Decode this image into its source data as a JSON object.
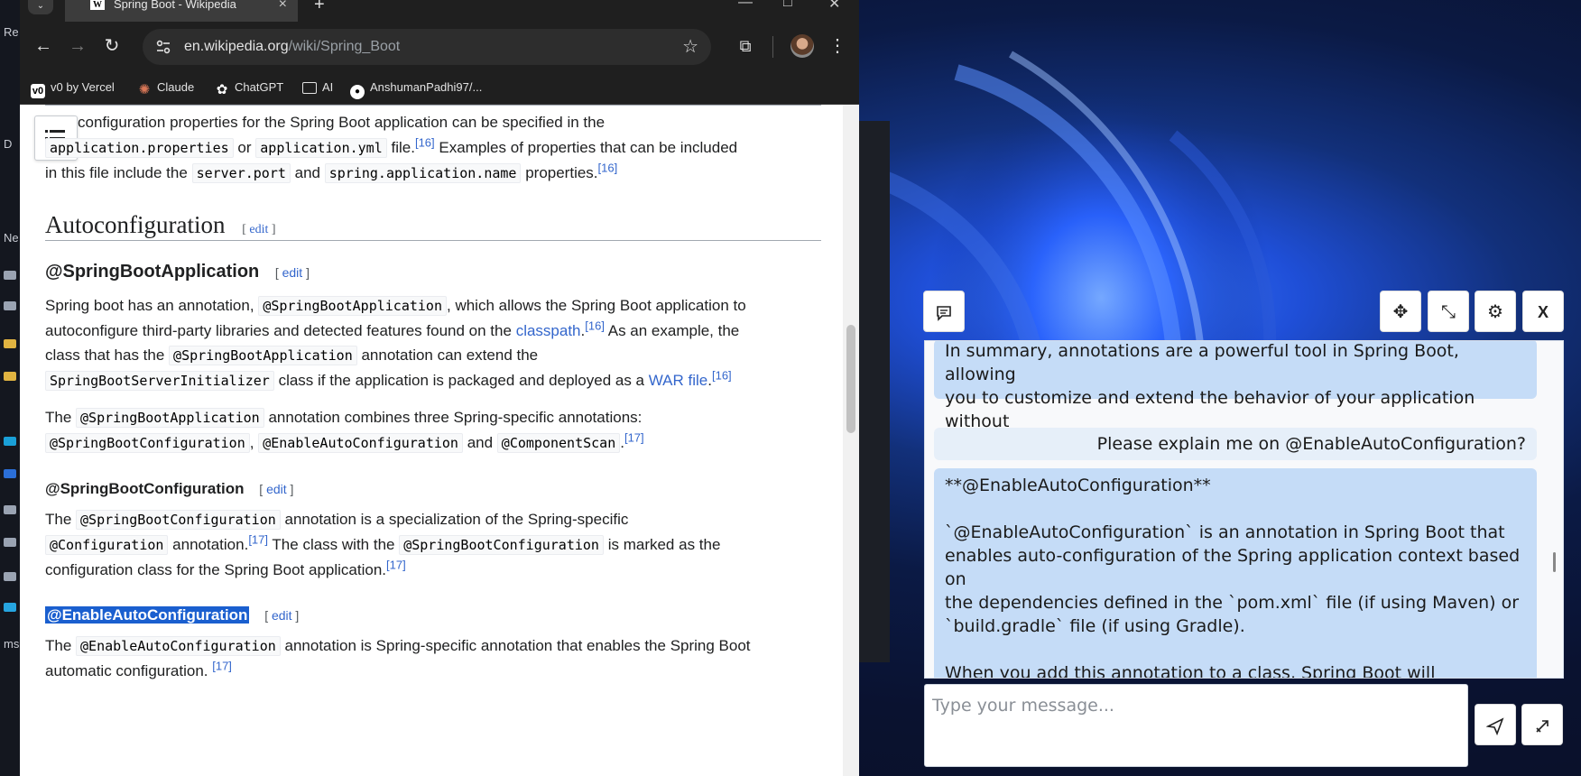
{
  "browser": {
    "tab_title": "Spring Boot - Wikipedia",
    "url_host": "en.wikipedia.org",
    "url_path": "/wiki/Spring_Boot",
    "bookmarks": [
      {
        "label": "v0 by Vercel"
      },
      {
        "label": "Claude"
      },
      {
        "label": "ChatGPT"
      },
      {
        "label": "AI"
      },
      {
        "label": "AnshumanPadhi97/..."
      }
    ]
  },
  "article": {
    "p1": {
      "a": "configuration properties for the Spring Boot application can be specified in the",
      "code1": "application.properties",
      "b": "or",
      "code2": "application.yml",
      "c": "file.",
      "ref1": "[16]",
      "d": "Examples of properties that can be included",
      "e": "in this file include the",
      "code3": "server.port",
      "f": "and",
      "code4": "spring.application.name",
      "g": "properties.",
      "ref2": "[16]"
    },
    "h_autoconfig": "Autoconfiguration",
    "edit_label": "edit",
    "h_sba": "@SpringBootApplication",
    "p2": {
      "a": "Spring boot has an annotation,",
      "code1": "@SpringBootApplication",
      "b": ", which allows the Spring Boot application to",
      "c": "autoconfigure third-party libraries and detected features found on the",
      "link1": "classpath",
      "ref1": "[16]",
      "d": "As an example, the",
      "e": "class that has the",
      "code2": "@SpringBootApplication",
      "f": "annotation can extend the",
      "code3": "SpringBootServerInitializer",
      "g": "class if the application is packaged and deployed as a",
      "link2": "WAR file",
      "ref2": "[16]"
    },
    "p3": {
      "a": "The",
      "code1": "@SpringBootApplication",
      "b": "annotation combines three Spring-specific annotations:",
      "code2": "@SpringBootConfiguration",
      "code3": "@EnableAutoConfiguration",
      "c": "and",
      "code4": "@ComponentScan",
      "ref1": "[17]"
    },
    "h_sbc": "@SpringBootConfiguration",
    "p4": {
      "a": "The",
      "code1": "@SpringBootConfiguration",
      "b": "annotation is a specialization of the Spring-specific",
      "code2": "@Configuration",
      "c": "annotation.",
      "ref1": "[17]",
      "d": "The class with the",
      "code3": "@SpringBootConfiguration",
      "e": "is marked as the",
      "f": "configuration class for the Spring Boot application.",
      "ref2": "[17]"
    },
    "h_eac": "@EnableAutoConfiguration",
    "p5": {
      "a": "The",
      "code1": "@EnableAutoConfiguration",
      "b": "annotation is Spring-specific annotation that enables the Spring Boot",
      "c": "automatic configuration.",
      "ref1": "[17]"
    }
  },
  "chat": {
    "close_label": "X",
    "messages": [
      {
        "role": "assistant",
        "text": "In summary, annotations are a powerful tool in Spring Boot, allowing\nyou to customize and extend the behavior of your application without\nmodifying the source code."
      },
      {
        "role": "user",
        "text": "Please explain me on @EnableAutoConfiguration?"
      },
      {
        "role": "assistant",
        "text": "**@EnableAutoConfiguration**\n\n`@EnableAutoConfiguration` is an annotation in Spring Boot that\nenables auto-configuration of the Spring application context based on\nthe dependencies defined in the `pom.xml` file (if using Maven) or\n`build.gradle` file (if using Gradle).\n\nWhen you add this annotation to a class, Spring Boot will automatically:"
      }
    ],
    "input_placeholder": "Type your message..."
  },
  "colors": {
    "accent": "#3366cc",
    "highlight": "#1a5fcf",
    "chat_bubble": "#c5dcf7"
  }
}
